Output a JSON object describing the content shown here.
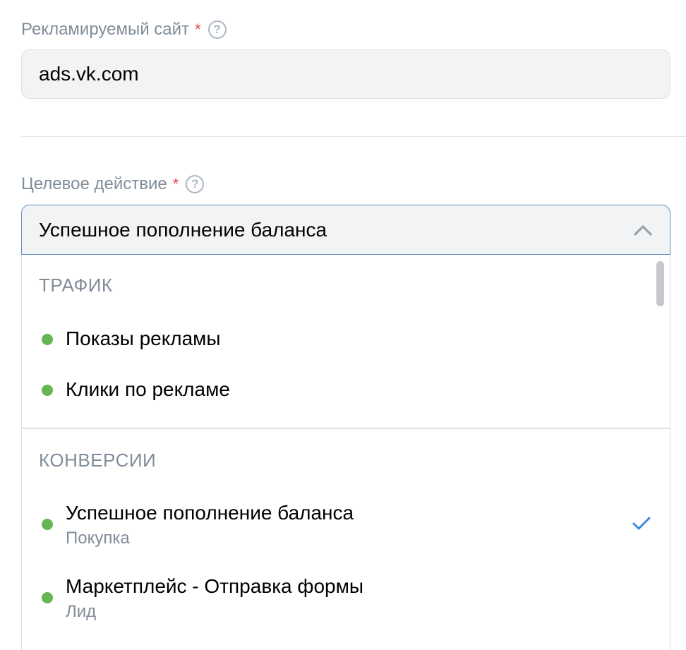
{
  "site_field": {
    "label": "Рекламируемый сайт",
    "required_mark": "*",
    "help_glyph": "?",
    "value": "ads.vk.com"
  },
  "action_field": {
    "label": "Целевое действие",
    "required_mark": "*",
    "help_glyph": "?",
    "selected": "Успешное пополнение баланса",
    "expanded": true
  },
  "dropdown": {
    "groups": [
      {
        "title": "ТРАФИК",
        "options": [
          {
            "title": "Показы рекламы"
          },
          {
            "title": "Клики по рекламе"
          }
        ]
      },
      {
        "title": "КОНВЕРСИИ",
        "options": [
          {
            "title": "Успешное пополнение баланса",
            "subtitle": "Покупка",
            "selected": true
          },
          {
            "title": "Маркетплейс - Отправка формы",
            "subtitle": "Лид"
          }
        ]
      }
    ]
  },
  "colors": {
    "status_dot": "#66b553",
    "accent": "#3f8ae0",
    "required": "#e64646",
    "secondary_text": "#818c99"
  },
  "icons": {
    "help": "question-circle-icon",
    "chevron": "chevron-up-icon",
    "check": "check-icon",
    "status": "green-dot-icon"
  }
}
